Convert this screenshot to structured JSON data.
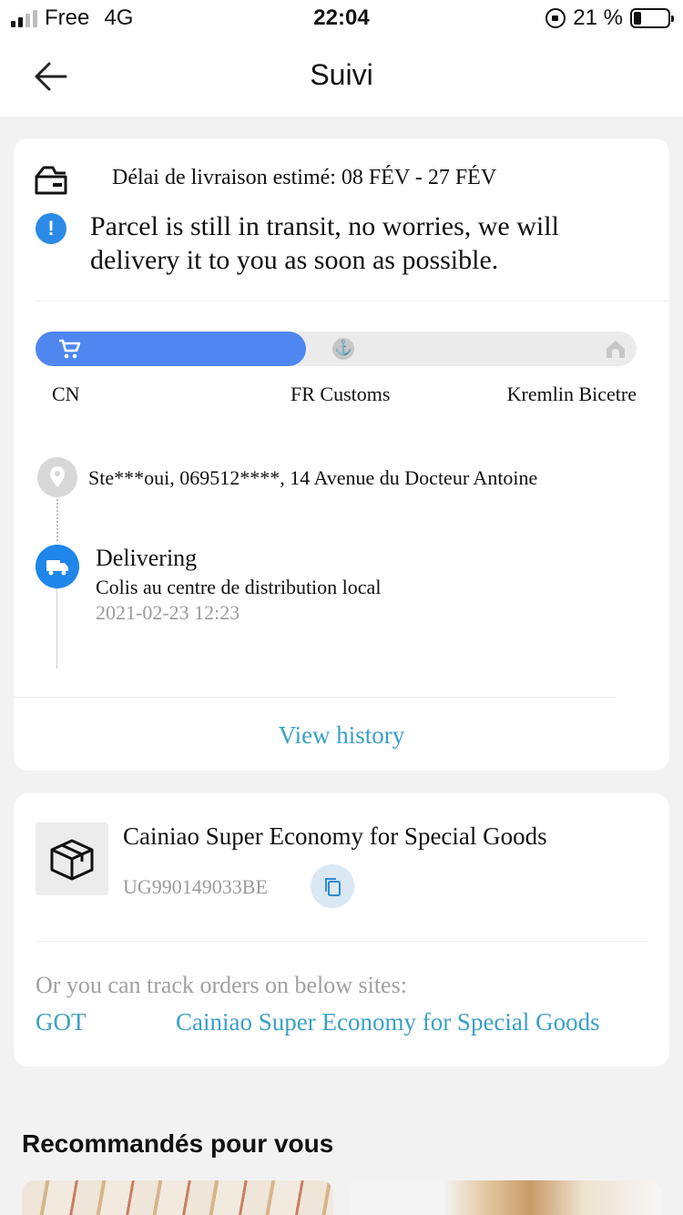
{
  "status_bar": {
    "carrier": "Free",
    "network": "4G",
    "time": "22:04",
    "battery": "21 %"
  },
  "header": {
    "title": "Suivi"
  },
  "tracking": {
    "eta": "Délai de livraison estimé: 08 FÉV - 27 FÉV",
    "notice": "Parcel is still in transit, no worries, we will delivery it to you as soon as possible.",
    "progress_fraction": 0.45,
    "stages": [
      "CN",
      "FR Customs",
      "Kremlin Bicetre"
    ],
    "address": "Ste***oui,  069512****,  14 Avenue du Docteur Antoine",
    "latest_event": {
      "title": "Delivering",
      "description": "Colis au centre de distribution local",
      "time": "2021-02-23 12:23"
    },
    "view_history": "View history"
  },
  "shipment": {
    "carrier": "Cainiao Super Economy for Special Goods",
    "tracking_number": "UG990149033BE",
    "other_sites_label": "Or you can track orders on below sites:",
    "sites": [
      "GOT",
      "Cainiao Super Economy for Special Goods"
    ]
  },
  "recommendations": {
    "title": "Recommandés pour vous"
  },
  "colors": {
    "accent_blue": "#4f86f0",
    "link": "#3aa0c8",
    "info_blue": "#2b8ae6"
  }
}
